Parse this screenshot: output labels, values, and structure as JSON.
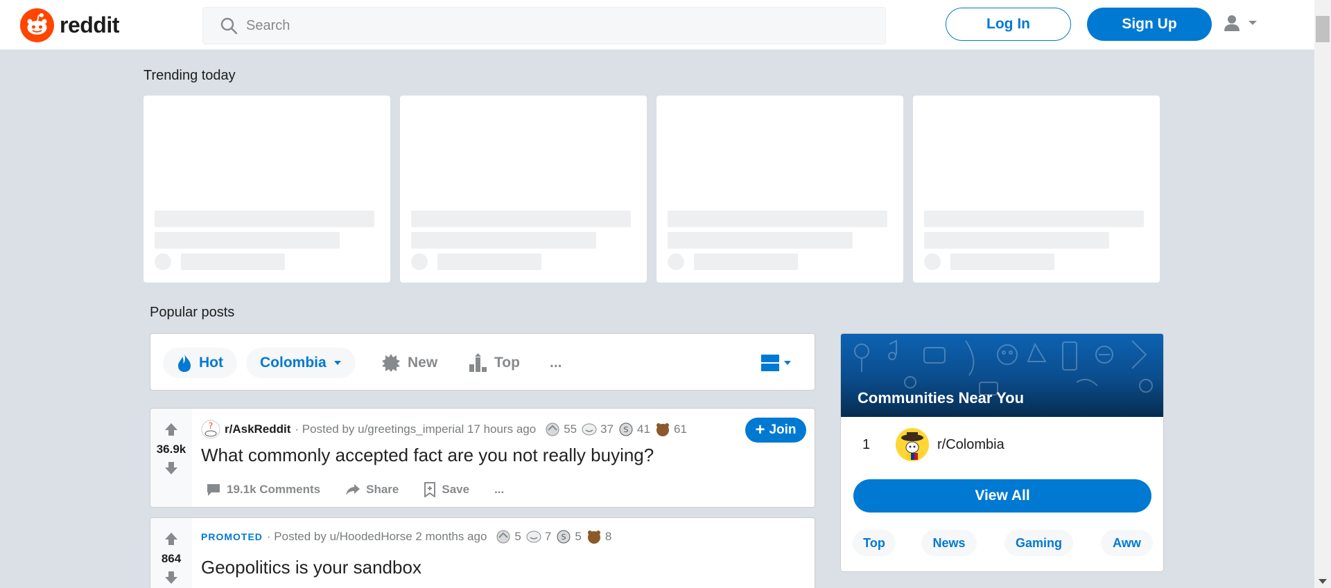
{
  "header": {
    "logo_text": "reddit",
    "search_placeholder": "Search",
    "login_label": "Log In",
    "signup_label": "Sign Up"
  },
  "trending": {
    "title": "Trending today"
  },
  "popular": {
    "title": "Popular posts",
    "sort": {
      "hot": "Hot",
      "location": "Colombia",
      "new": "New",
      "top": "Top",
      "more": "..."
    }
  },
  "posts": [
    {
      "votes": "36.9k",
      "subreddit": "r/AskReddit",
      "posted_by": "· Posted by u/greetings_imperial 17 hours ago",
      "awards": [
        "55",
        "37",
        "41",
        "61"
      ],
      "join_label": "Join",
      "title": "What commonly accepted fact are you not really buying?",
      "comments": "19.1k Comments",
      "share": "Share",
      "save": "Save",
      "more": "..."
    },
    {
      "votes": "864",
      "promoted": "PROMOTED",
      "posted_by": "· Posted by u/HoodedHorse 2 months ago",
      "awards": [
        "5",
        "7",
        "5",
        "8"
      ],
      "title": "Geopolitics is your sandbox"
    }
  ],
  "communities": {
    "title": "Communities Near You",
    "items": [
      {
        "rank": "1",
        "name": "r/Colombia"
      }
    ],
    "view_all": "View All",
    "tags": [
      "Top",
      "News",
      "Gaming",
      "Aww"
    ]
  },
  "colors": {
    "brand": "#ff4500",
    "accent": "#0079d3",
    "background": "#dae0e6"
  }
}
